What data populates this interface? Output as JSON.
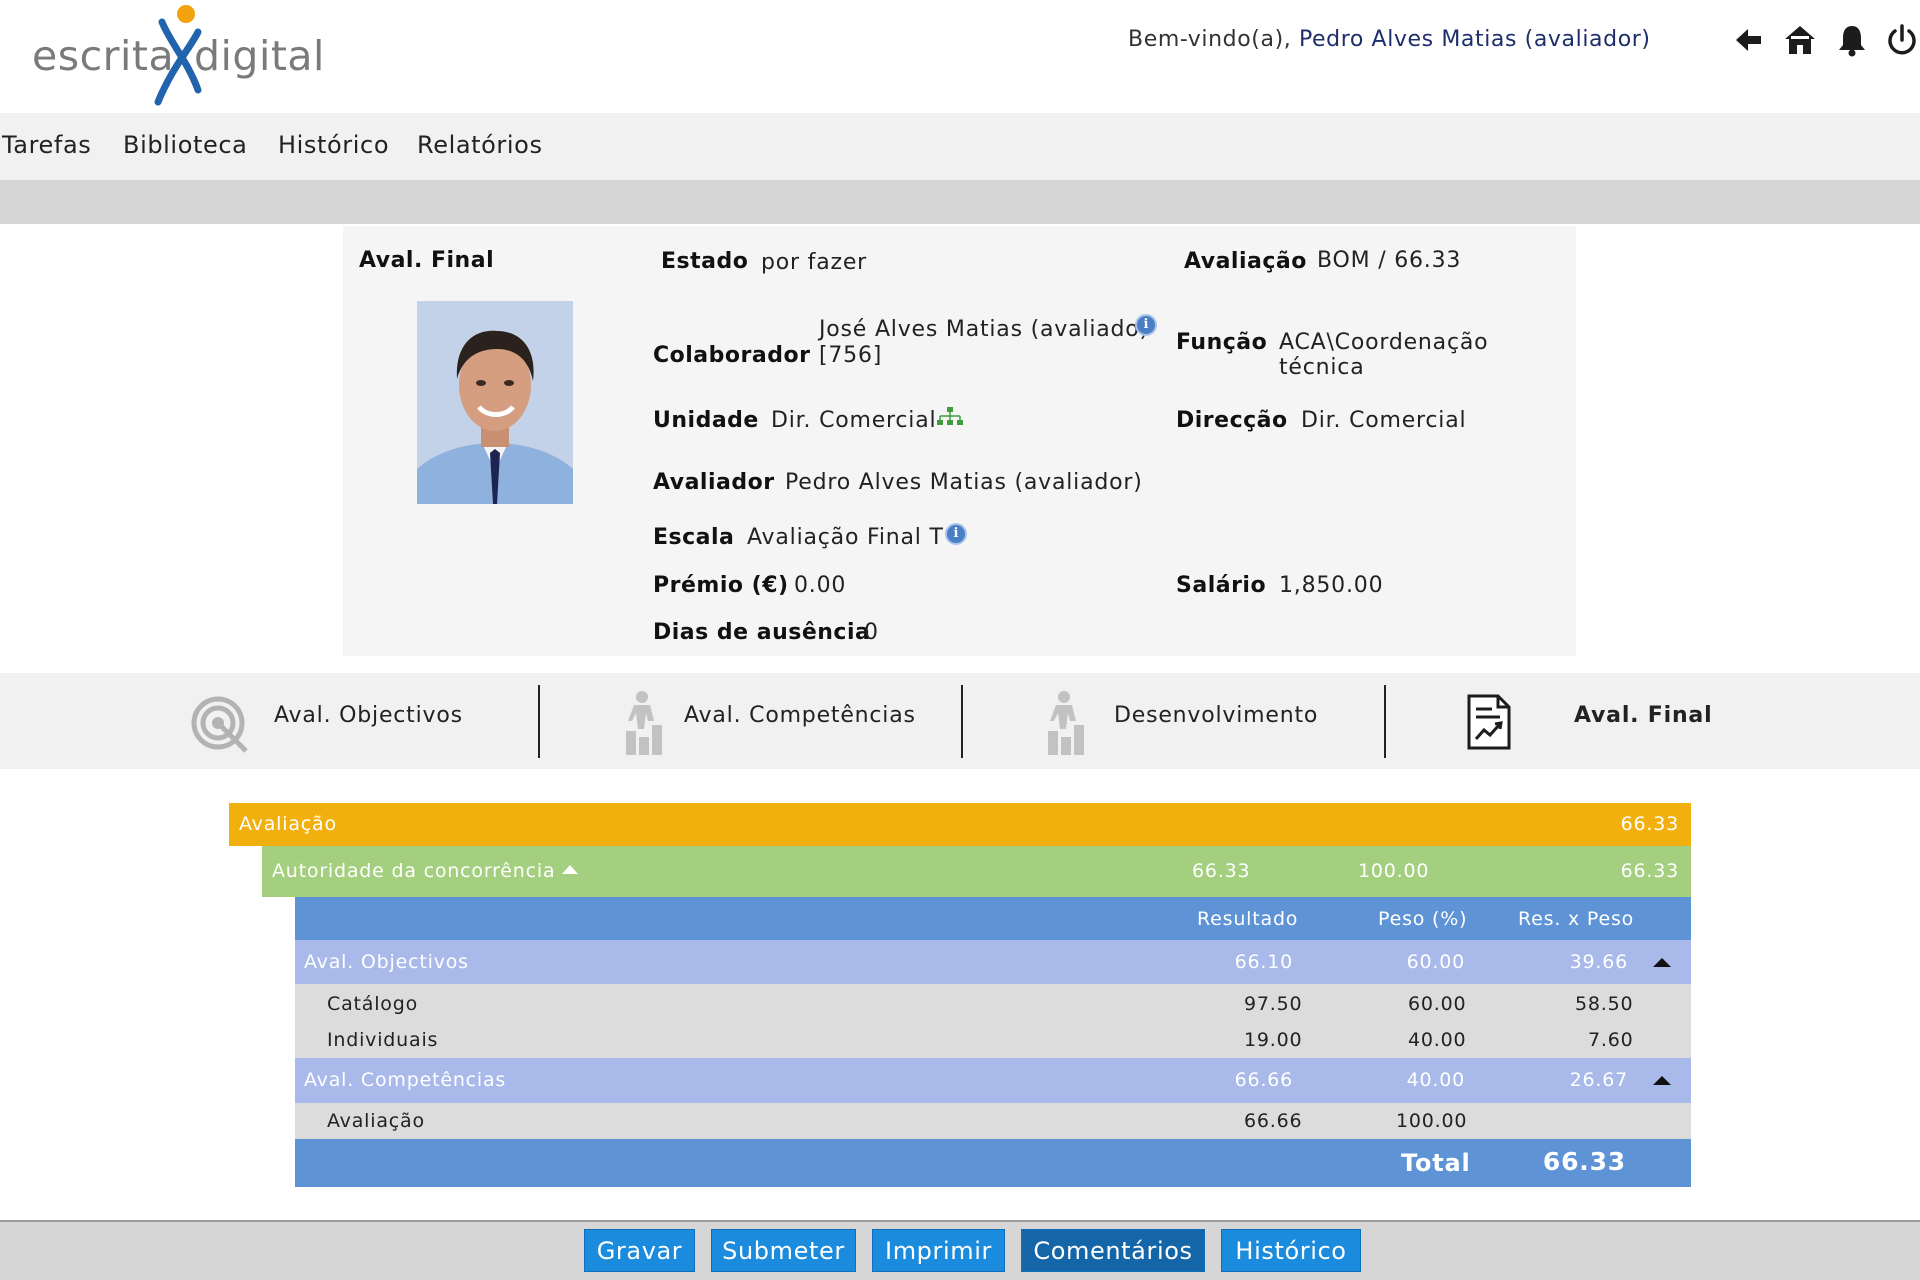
{
  "brand": {
    "logo_word1": "escrita",
    "logo_word2": "digital"
  },
  "header": {
    "welcome_prefix": "Bem-vindo(a),",
    "welcome_user": "Pedro Alves Matias (avaliador)",
    "icons": [
      "back-arrow-icon",
      "home-icon",
      "bell-icon",
      "power-icon"
    ]
  },
  "nav": {
    "items": [
      "Tarefas",
      "Biblioteca",
      "Histórico",
      "Relatórios"
    ]
  },
  "info": {
    "section_title": "Aval. Final",
    "estado_label": "Estado",
    "estado_value": "por fazer",
    "avaliacao_label": "Avaliação",
    "avaliacao_value": "BOM / 66.33",
    "colaborador_label": "Colaborador",
    "colaborador_line1": "José Alves Matias (avaliado)",
    "colaborador_line2": "[756]",
    "funcao_label": "Função",
    "funcao_value": "ACA\\Coordenação técnica",
    "unidade_label": "Unidade",
    "unidade_value": "Dir. Comercial",
    "direccao_label": "Direcção",
    "direccao_value": "Dir. Comercial",
    "avaliador_label": "Avaliador",
    "avaliador_value": "Pedro Alves Matias (avaliador)",
    "escala_label": "Escala",
    "escala_value": "Avaliação Final T",
    "premio_label": "Prémio (€)",
    "premio_value": "0.00",
    "salario_label": "Salário",
    "salario_value": "1,850.00",
    "dias_label": "Dias de ausência",
    "dias_value": "0"
  },
  "tabs": [
    {
      "label": "Aval. Objectivos",
      "icon": "target-icon"
    },
    {
      "label": "Aval. Competências",
      "icon": "person-steps-icon"
    },
    {
      "label": "Desenvolvimento",
      "icon": "person-steps-icon"
    },
    {
      "label": "Aval. Final",
      "icon": "report-chart-icon",
      "active": true
    }
  ],
  "results": {
    "top": {
      "label": "Avaliação",
      "value": "66.33",
      "color": "#f2b00f"
    },
    "group": {
      "label": "Autoridade da concorrência",
      "resultado": "66.33",
      "peso": "100.00",
      "res_peso": "66.33",
      "color": "#a3cf7f"
    },
    "headers": {
      "resultado": "Resultado",
      "peso": "Peso (%)",
      "res_peso": "Res. x Peso"
    },
    "sections": [
      {
        "label": "Aval. Objectivos",
        "resultado": "66.10",
        "peso": "60.00",
        "res_peso": "39.66",
        "rows": [
          {
            "label": "Catálogo",
            "resultado": "97.50",
            "peso": "60.00",
            "res_peso": "58.50"
          },
          {
            "label": "Individuais",
            "resultado": "19.00",
            "peso": "40.00",
            "res_peso": "7.60"
          }
        ]
      },
      {
        "label": "Aval. Competências",
        "resultado": "66.66",
        "peso": "40.00",
        "res_peso": "26.67",
        "rows": [
          {
            "label": "Avaliação",
            "resultado": "66.66",
            "peso": "100.00",
            "res_peso": ""
          }
        ]
      }
    ],
    "total_label": "Total",
    "total_value": "66.33",
    "header_color": "#5e94d6",
    "section_color": "#a8b9ea"
  },
  "footer": {
    "buttons": [
      "Gravar",
      "Submeter",
      "Imprimir",
      "Comentários",
      "Histórico"
    ]
  }
}
